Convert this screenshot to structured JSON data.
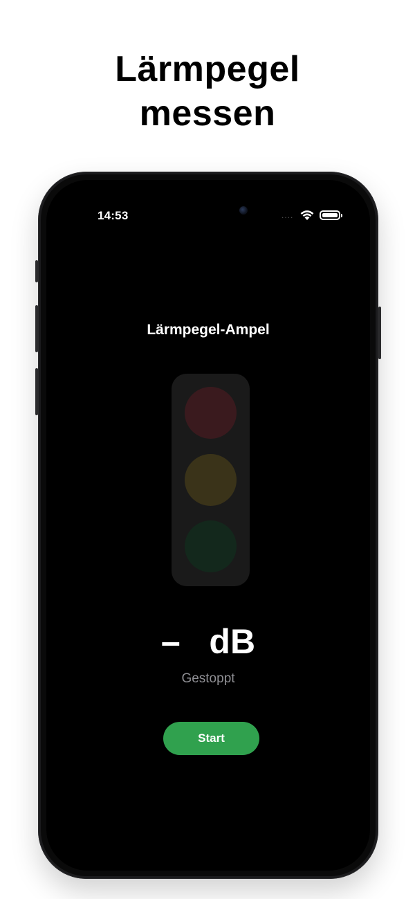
{
  "headline": {
    "line1": "Lärmpegel",
    "line2": "messen"
  },
  "status_bar": {
    "time": "14:53",
    "signal_dots": "....",
    "icons": [
      "wifi-icon",
      "battery-icon"
    ]
  },
  "app": {
    "title": "Lärmpegel-Ampel",
    "traffic_light": {
      "lamps": [
        {
          "name": "red",
          "color": "#3a1a1e",
          "active": false
        },
        {
          "name": "yellow",
          "color": "#3a3319",
          "active": false
        },
        {
          "name": "green",
          "color": "#13281c",
          "active": false
        }
      ]
    },
    "reading": {
      "value": "–",
      "unit": "dB",
      "status": "Gestoppt"
    },
    "start_button": {
      "label": "Start",
      "color": "#30a14e"
    }
  }
}
